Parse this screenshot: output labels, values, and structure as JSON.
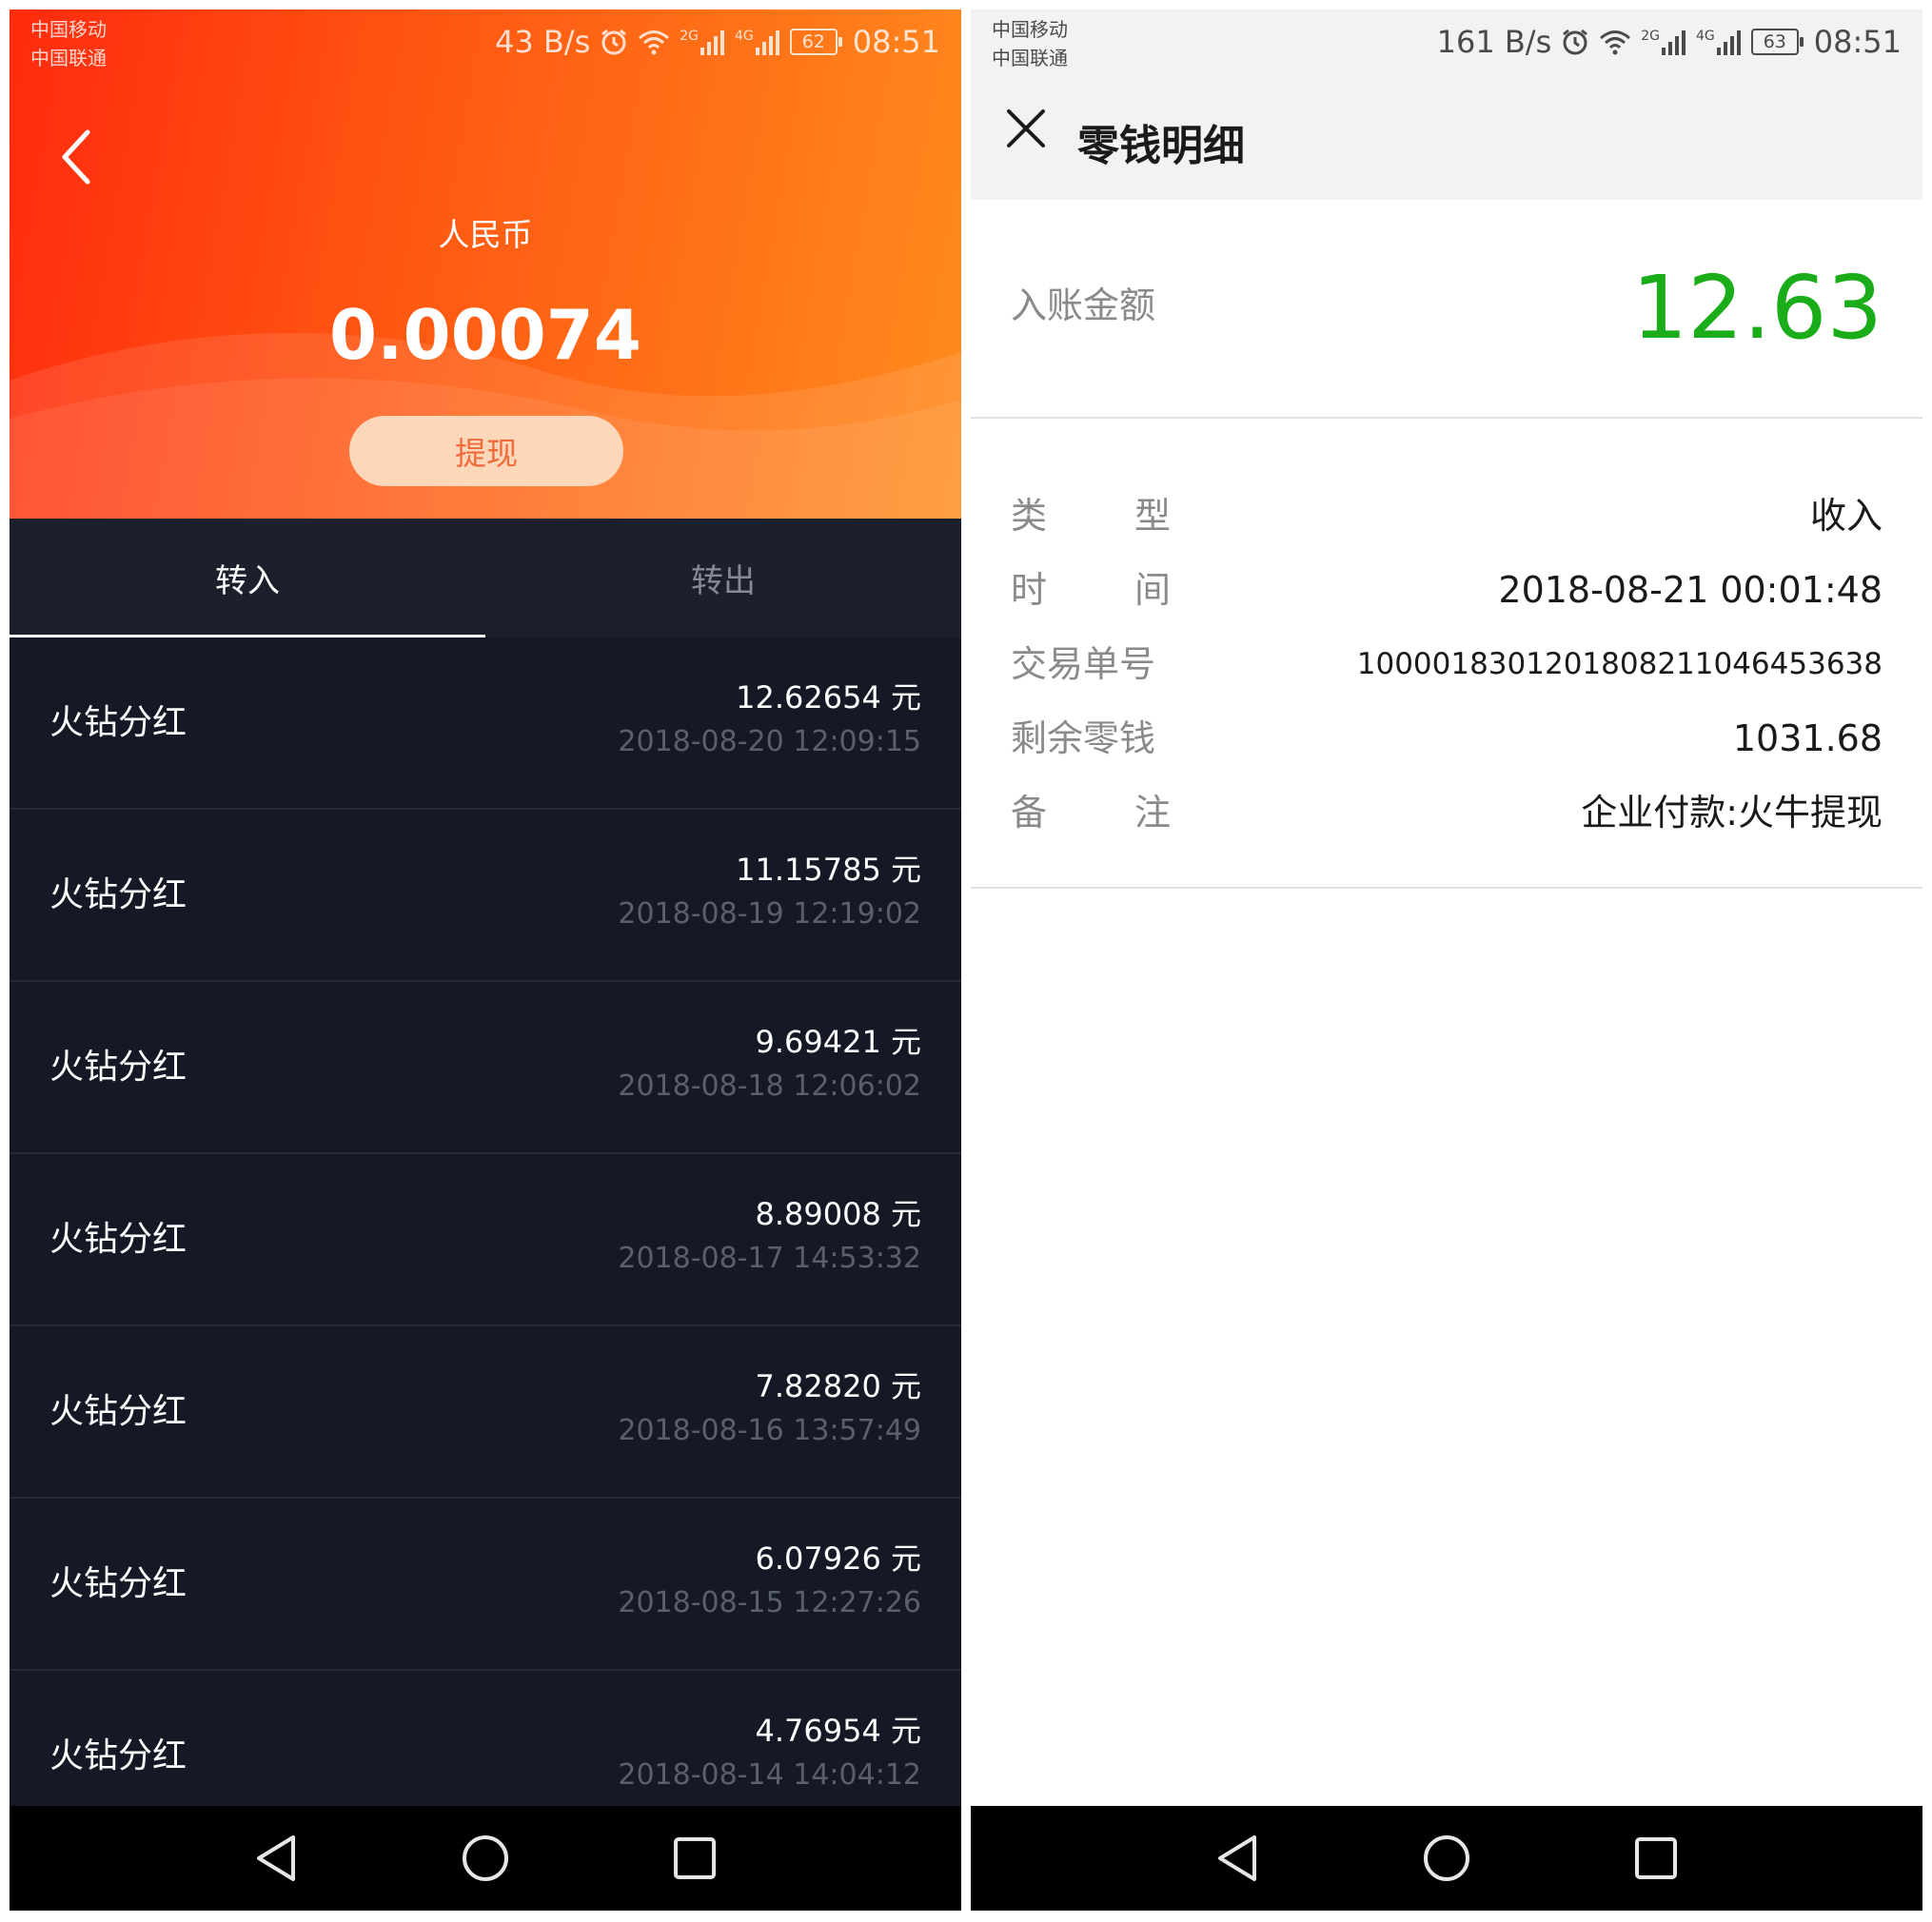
{
  "left": {
    "status": {
      "carrier_1": "中国移动",
      "carrier_2": "中国联通",
      "net_speed": "43 B/s",
      "net_1": "2G",
      "net_2": "4G",
      "battery": "62",
      "time": "08:51"
    },
    "hero": {
      "currency": "人民币",
      "balance": "0.00074",
      "withdraw_label": "提现"
    },
    "tabs": [
      {
        "label": "转入",
        "active": true
      },
      {
        "label": "转出",
        "active": false
      }
    ],
    "transactions": [
      {
        "title": "火钻分红",
        "amount": "12.62654 元",
        "date": "2018-08-20 12:09:15"
      },
      {
        "title": "火钻分红",
        "amount": "11.15785 元",
        "date": "2018-08-19 12:19:02"
      },
      {
        "title": "火钻分红",
        "amount": "9.69421 元",
        "date": "2018-08-18 12:06:02"
      },
      {
        "title": "火钻分红",
        "amount": "8.89008 元",
        "date": "2018-08-17 14:53:32"
      },
      {
        "title": "火钻分红",
        "amount": "7.82820 元",
        "date": "2018-08-16 13:57:49"
      },
      {
        "title": "火钻分红",
        "amount": "6.07926 元",
        "date": "2018-08-15 12:27:26"
      },
      {
        "title": "火钻分红",
        "amount": "4.76954 元",
        "date": "2018-08-14 14:04:12"
      }
    ]
  },
  "right": {
    "status": {
      "carrier_1": "中国移动",
      "carrier_2": "中国联通",
      "net_speed": "161 B/s",
      "net_1": "2G",
      "net_2": "4G",
      "battery": "63",
      "time": "08:51"
    },
    "title": "零钱明细",
    "amount_label": "入账金额",
    "amount_value": "12.63",
    "details": {
      "type_label": [
        "类",
        "型"
      ],
      "type_value": "收入",
      "time_label": [
        "时",
        "间"
      ],
      "time_value": "2018-08-21 00:01:48",
      "txn_label": "交易单号",
      "txn_value": "1000018301201808211046453638",
      "balance_label": "剩余零钱",
      "balance_value": "1031.68",
      "note_label": [
        "备",
        "注"
      ],
      "note_value": "企业付款:火牛提现"
    }
  },
  "colors": {
    "hero_start": "#ff2b0e",
    "hero_end": "#ff8c1e",
    "amount_green": "#1aad19",
    "list_bg": "#141925"
  },
  "icons": [
    "back-arrow-icon",
    "close-icon",
    "alarm-icon",
    "wifi-icon",
    "signal-icon",
    "battery-icon",
    "nav-back-icon",
    "nav-home-icon",
    "nav-recents-icon"
  ]
}
